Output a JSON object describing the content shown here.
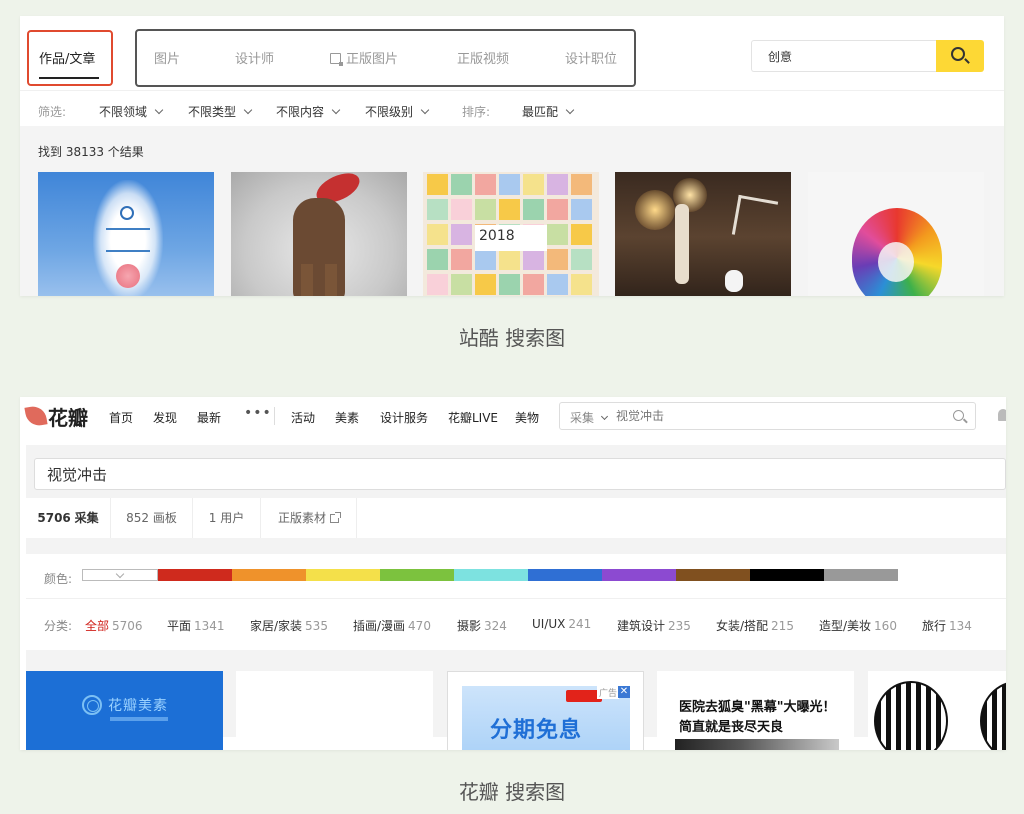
{
  "zcool": {
    "works_tab": "作品/文章",
    "tabs": [
      "图片",
      "设计师",
      "正版图片",
      "正版视频",
      "设计职位"
    ],
    "search_value": "创意",
    "filters": {
      "label": "筛选:",
      "field": "不限领域",
      "type": "不限类型",
      "content": "不限内容",
      "level": "不限级别",
      "sort_label": "排序:",
      "sort_value": "最匹配"
    },
    "result_count": "找到 38133 个结果",
    "thumb_year": "2018",
    "caption": "站酷 搜索图"
  },
  "huaban": {
    "logo": "花瓣",
    "nav": [
      "首页",
      "发现",
      "最新",
      "活动",
      "美素",
      "设计服务",
      "花瓣LIVE",
      "美物"
    ],
    "more": "•••",
    "search_category": "采集",
    "search_placeholder": "视觉冲击",
    "query": "视觉冲击",
    "tabs": {
      "pins_count": "5706",
      "pins_label": "采集",
      "boards": "852 画板",
      "users": "1 用户",
      "assets": "正版素材"
    },
    "color_label": "颜色:",
    "colors": [
      "#cf2a1d",
      "#ef922b",
      "#f4e04a",
      "#7cc23e",
      "#7de2e0",
      "#2f6fd4",
      "#8c4ad1",
      "#80501f",
      "#000000",
      "#999999",
      "#ffffff"
    ],
    "category_label": "分类:",
    "categories": [
      {
        "name": "全部",
        "count": "5706"
      },
      {
        "name": "平面",
        "count": "1341"
      },
      {
        "name": "家居/家装",
        "count": "535"
      },
      {
        "name": "插画/漫画",
        "count": "470"
      },
      {
        "name": "摄影",
        "count": "324"
      },
      {
        "name": "UI/UX",
        "count": "241"
      },
      {
        "name": "建筑设计",
        "count": "235"
      },
      {
        "name": "女装/搭配",
        "count": "215"
      },
      {
        "name": "造型/美妆",
        "count": "160"
      },
      {
        "name": "旅行",
        "count": "134"
      }
    ],
    "cards": {
      "card1_title": "花瓣美素",
      "ad_tag": "广告",
      "ad_close": "✕",
      "ad_headline": "分期免息",
      "news_line1": "医院去狐臭\"黑幕\"大曝光！",
      "news_line2": "简直就是丧尽天良"
    },
    "caption": "花瓣 搜索图"
  },
  "icons": {
    "search": "search-icon",
    "chevron": "chevron-down-icon",
    "external": "external-link-icon",
    "bell": "bell-icon"
  }
}
